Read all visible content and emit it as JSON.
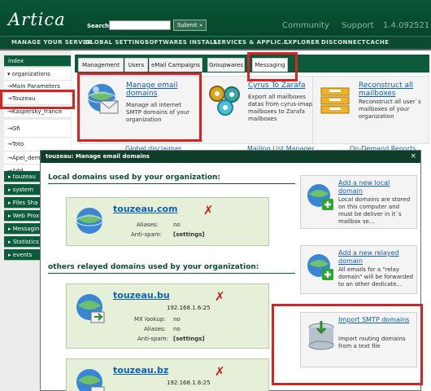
{
  "header": {
    "logo": "Artica",
    "search_label": "Search:",
    "search_value": "",
    "submit": "Submit »",
    "links": [
      "Community",
      "Support"
    ],
    "version": "1.4.092521"
  },
  "nav": [
    "MANAGE YOUR SERVER",
    "GLOBAL SETTINGS",
    "SOFTWARES INSTALL",
    "SERVICES & APPLIC...",
    "EXPLORER",
    "DISCONNECT",
    "CACHE"
  ],
  "sidebar": {
    "items": [
      {
        "label": "index",
        "style": "dark"
      },
      {
        "label": "▾ organizations",
        "style": "light"
      },
      {
        "label": "→Main Parameters",
        "style": "light"
      },
      {
        "label": "→Touzeau",
        "style": "light"
      },
      {
        "label": "→Kaspersky_france",
        "style": "light"
      },
      {
        "label": "→Gfi",
        "style": "light"
      },
      {
        "label": "→Toto",
        "style": "light"
      },
      {
        "label": "→Apel_dem",
        "style": "light"
      },
      {
        "label": "→Add",
        "style": "light"
      },
      {
        "label": "▸ touzeau",
        "style": "dark"
      },
      {
        "label": "▸ system",
        "style": "dark"
      },
      {
        "label": "▸ Files Sha",
        "style": "dark"
      },
      {
        "label": "▸ Web Prox",
        "style": "dark"
      },
      {
        "label": "▸ Messagin",
        "style": "dark"
      },
      {
        "label": "▸ Statistics",
        "style": "dark"
      },
      {
        "label": "▸ events",
        "style": "dark"
      }
    ]
  },
  "tabs": [
    "Management",
    "Users",
    "eMail Campaigns",
    "Groupwares",
    "Messaging"
  ],
  "cards": [
    {
      "title": "Manage email domains",
      "desc": "Manage all internet SMTP domains of your organization"
    },
    {
      "title": "Cyrus To Zarafa",
      "desc": "Export all mailboxes datas from cyrus-imap mailboxes to Zarafa mailboxes"
    },
    {
      "title": "Reconstruct all mailboxes",
      "desc": "Reconstruct all user`s mailboxes of your organization"
    }
  ],
  "behind_cards": [
    "Global disclaimer",
    "Mailing List Manager",
    "On-Demand Reports"
  ],
  "modal": {
    "title": "touzeau: Manage email domains",
    "close": "×",
    "local_heading": "Local domains used by your organization:",
    "relayed_heading": "others relayed domains used by your organization:",
    "local_domain": {
      "name": "touzeau.com",
      "aliases_label": "Aliases:",
      "aliases": "no",
      "antispam_label": "Anti-spam:",
      "antispam": "[settings]"
    },
    "relayed_domains": [
      {
        "name": "touzeau.bu",
        "ip": "192.168.1.6:25",
        "mx_label": "MX lookup:",
        "mx": "no",
        "aliases_label": "Aliases:",
        "aliases": "no",
        "antispam_label": "Anti-spam:",
        "antispam": "[settings]"
      },
      {
        "name": "touzeau.bz",
        "ip": "192.168.1.6:25"
      }
    ],
    "actions": [
      {
        "title": "Add a new local domain",
        "desc": "Local domains are stored on this computer and must be deliver in it`s mailbox se..."
      },
      {
        "title": "Add a new relayed domain",
        "desc": "All emails for a \"relay domain\" will be forwarded to an other dedicate..."
      },
      {
        "title": "Import SMTP domains",
        "desc": "Import routing domains from a text file"
      }
    ]
  },
  "colors": {
    "brand_green": "#0c5b3a",
    "link_blue": "#0e5fb0",
    "highlight_red": "#d42424",
    "delete_red": "#d11a1a"
  }
}
